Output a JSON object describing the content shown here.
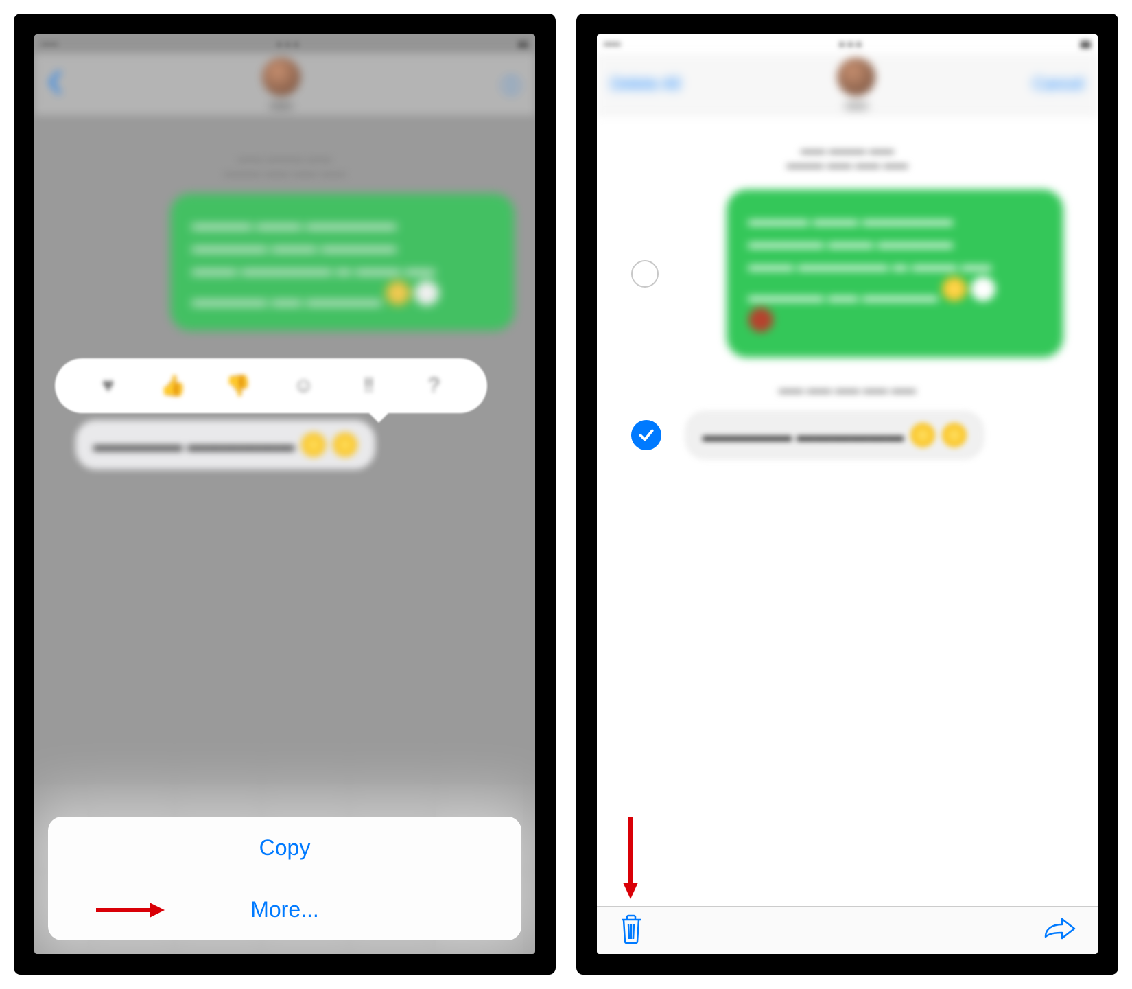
{
  "left": {
    "action_sheet": {
      "copy_label": "Copy",
      "more_label": "More..."
    },
    "tapbacks": [
      "heart-icon",
      "thumbs-up-icon",
      "thumbs-down-icon",
      "haha-icon",
      "exclaim-icon",
      "question-icon"
    ]
  },
  "right": {
    "nav": {
      "left_label": "Delete All",
      "right_label": "Cancel"
    }
  },
  "colors": {
    "ios_blue": "#007aff",
    "red_arrow": "#d90007",
    "green_bubble": "#34c759"
  }
}
